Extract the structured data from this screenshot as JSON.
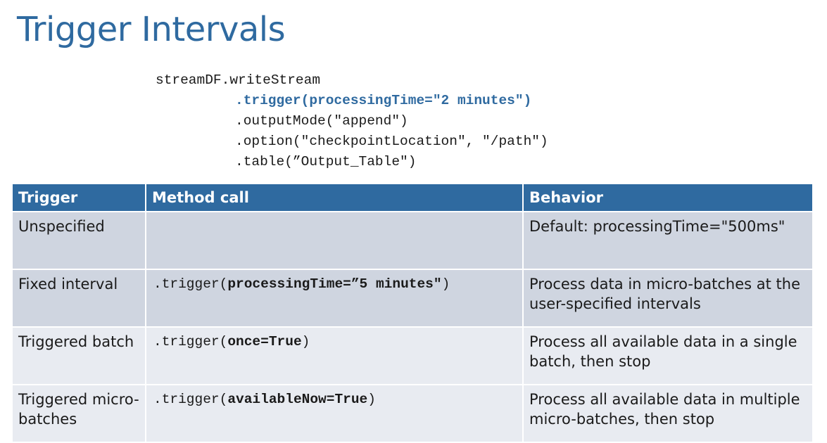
{
  "slide": {
    "title": "Trigger Intervals"
  },
  "code": {
    "line1": "streamDF.writeStream",
    "line2": ".trigger(processingTime=\"2 minutes\")",
    "line3": ".outputMode(\"append\")",
    "line4": ".option(\"checkpointLocation\", \"/path\")",
    "line5": ".table(”Output_Table\")"
  },
  "table": {
    "headers": [
      "Trigger",
      "Method call",
      "Behavior"
    ],
    "rows": [
      {
        "trigger": "Unspecified",
        "method_prefix": "",
        "method_arg": "",
        "method_suffix": "",
        "behavior": "Default: processingTime=\"500ms\""
      },
      {
        "trigger": "Fixed interval",
        "method_prefix": ".trigger(",
        "method_arg": "processingTime=”5 minutes\"",
        "method_suffix": ")",
        "behavior": "Process data in micro-batches at the user-specified intervals"
      },
      {
        "trigger": "Triggered batch",
        "method_prefix": ".trigger(",
        "method_arg": "once=True",
        "method_suffix": ")",
        "behavior": "Process all available data in a single batch, then stop"
      },
      {
        "trigger": "Triggered micro-batches",
        "method_prefix": ".trigger(",
        "method_arg": "availableNow=True",
        "method_suffix": ")",
        "behavior": "Process all available data in multiple micro-batches, then stop"
      }
    ]
  },
  "colors": {
    "accent": "#2f6aa0",
    "row_dark": "#cfd5e0",
    "row_light": "#e8ebf1"
  }
}
